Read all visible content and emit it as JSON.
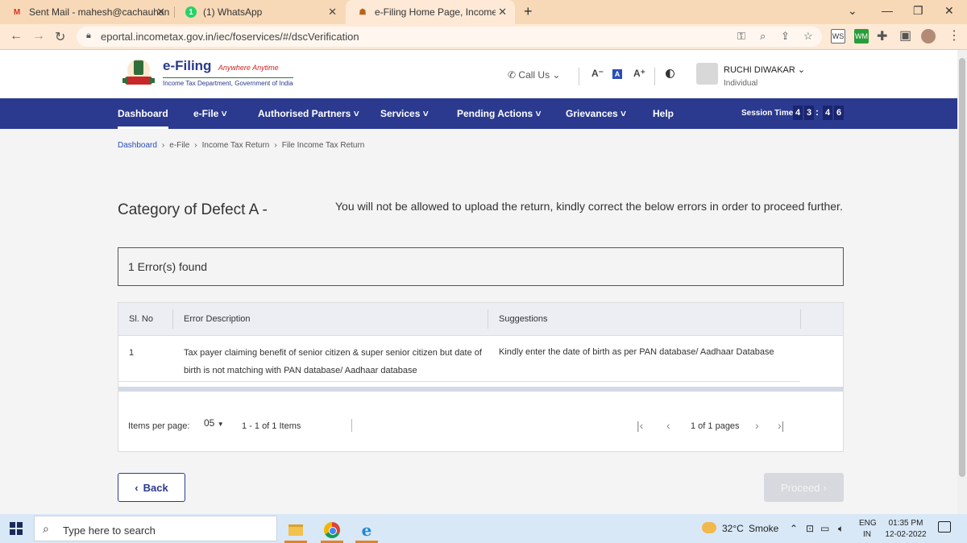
{
  "browser": {
    "tabs": [
      {
        "title": "Sent Mail - mahesh@cachauhan",
        "icon": "gmail-icon"
      },
      {
        "title": "(1) WhatsApp",
        "icon": "whatsapp-icon"
      },
      {
        "title": "e-Filing Home Page, Income Tax",
        "icon": "efiling-icon",
        "active": true
      }
    ],
    "url": "eportal.incometax.gov.in/iec/foservices/#/dscVerification",
    "extensions": [
      "WS",
      "WM"
    ]
  },
  "site": {
    "logo_main": "e-Filing",
    "logo_tagline": "Anywhere Anytime",
    "logo_sub": "Income Tax Department, Government of India",
    "call_us": "Call Us",
    "font_small": "A⁻",
    "font_normal": "A",
    "font_large": "A⁺",
    "user_name": "RUCHI DIWAKAR",
    "user_type": "Individual"
  },
  "nav": {
    "items": [
      "Dashboard",
      "e-File ˅",
      "Authorised Partners ˅",
      "Services ˅",
      "Pending Actions ˅",
      "Grievances ˅",
      "Help"
    ],
    "session_label": "Session Time",
    "session_digits": [
      "4",
      "3",
      "4",
      "6"
    ]
  },
  "breadcrumb": [
    "Dashboard",
    "e-File",
    "Income Tax Return",
    "File Income Tax Return"
  ],
  "page": {
    "defect_title": "Category of Defect A -",
    "defect_message": "You will not be allowed to upload the return, kindly correct the below errors in order to proceed further.",
    "error_count": "1 Error(s) found"
  },
  "table": {
    "headers": [
      "Sl. No",
      "Error Description",
      "Suggestions"
    ],
    "rows": [
      {
        "sl": "1",
        "description": "Tax payer claiming benefit of senior citizen & super senior citizen but date of birth is not matching with PAN database/ Aadhaar database",
        "suggestion": "Kindly enter the date of birth as per PAN database/ Aadhaar Database"
      }
    ],
    "pager": {
      "items_per_page_label": "Items per page:",
      "items_per_page_value": "05",
      "range": "1 - 1 of 1 Items",
      "pages": "1 of 1 pages"
    }
  },
  "buttons": {
    "back": "Back",
    "proceed": "Proceed"
  },
  "taskbar": {
    "search_placeholder": "Type here to search",
    "temperature": "32°C",
    "weather": "Smoke",
    "lang_top": "ENG",
    "lang_bottom": "IN",
    "time": "01:35 PM",
    "date": "12-02-2022"
  }
}
